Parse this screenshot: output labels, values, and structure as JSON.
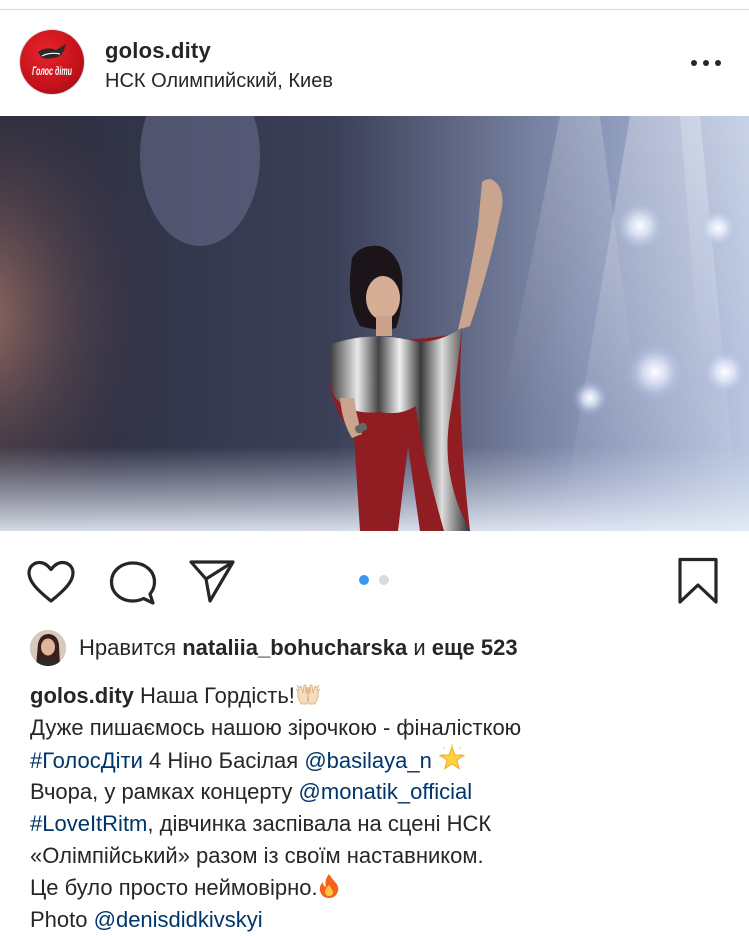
{
  "post": {
    "username": "golos.dity",
    "location": "НСК Олимпийский, Киев",
    "avatar_logo_text": "Голос діти"
  },
  "likes": {
    "prefix": "Нравится",
    "user": "nataliia_bohucharska",
    "middle": "и",
    "rest": "еще 523"
  },
  "carousel": {
    "count": 2,
    "active_index": 0,
    "active_color": "#3897f0",
    "inactive_color": "#dbdbdb"
  },
  "caption": {
    "username": "golos.dity",
    "l1_text": "Наша Гордість!",
    "l2_text": "Дуже пишаємось нашою зірочкою - фіналісткою",
    "l3_tag": "#ГолосДіти",
    "l3_text": "4 Ніно Басілая",
    "l3_mention": "@basilaya_n",
    "l4_text": "Вчора, у рамках концерту",
    "l4_mention": "@monatik_official",
    "l5_tag": "#LoveItRitm",
    "l5_text": ", дівчинка заспівала на сцені НСК",
    "l6_text": "«Олімпійський» разом із своїм наставником.",
    "l7_text": "Це було просто неймовірно.",
    "l8_text": "Photo",
    "l8_mention": "@denisdidkivskyi"
  },
  "icons": {
    "more": "more-options-icon",
    "like": "heart-icon",
    "comment": "comment-icon",
    "share": "paper-plane-icon",
    "save": "bookmark-icon",
    "emoji_hands": "raised-hands-emoji",
    "emoji_star": "glowing-star-emoji",
    "emoji_fire": "fire-emoji"
  },
  "colors": {
    "text": "#262626",
    "link": "#003569",
    "brand_red": "#d0161e"
  }
}
